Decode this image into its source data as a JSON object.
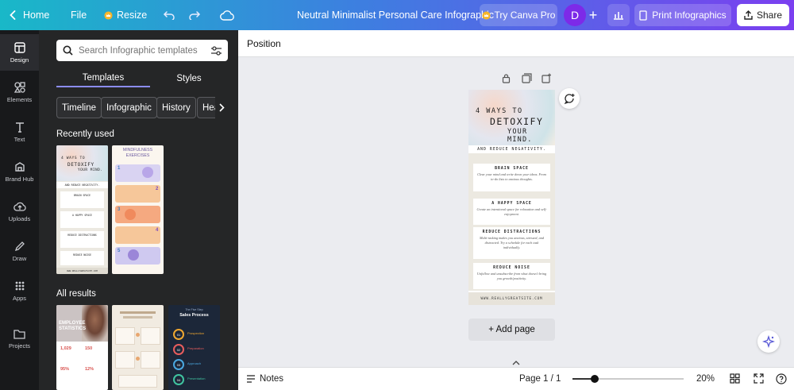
{
  "topbar": {
    "home_label": "Home",
    "file_label": "File",
    "resize_label": "Resize",
    "doc_title": "Neutral Minimalist Personal Care Infographic",
    "try_pro_label": "Try Canva Pro",
    "avatar_letter": "D",
    "print_label": "Print Infographics",
    "share_label": "Share"
  },
  "rail": {
    "items": [
      {
        "label": "Design",
        "icon": "design-icon"
      },
      {
        "label": "Elements",
        "icon": "elements-icon"
      },
      {
        "label": "Text",
        "icon": "text-icon"
      },
      {
        "label": "Brand Hub",
        "icon": "brand-hub-icon"
      },
      {
        "label": "Uploads",
        "icon": "uploads-icon"
      },
      {
        "label": "Draw",
        "icon": "draw-icon"
      },
      {
        "label": "Apps",
        "icon": "apps-icon"
      },
      {
        "label": "Projects",
        "icon": "projects-icon"
      }
    ]
  },
  "panel": {
    "search_placeholder": "Search Infographic templates",
    "tabs": [
      "Templates",
      "Styles"
    ],
    "chips": [
      "Timeline",
      "Infographic",
      "History",
      "Hea"
    ],
    "recently_used_title": "Recently used",
    "all_results_title": "All results",
    "thumb_detox": {
      "l1": "4 WAYS TO",
      "l2": "DETOXIFY",
      "l3": "YOUR MIND.",
      "l4": "AND REDUCE NEGATIVITY.",
      "sections": [
        "BRAIN SPACE",
        "A HAPPY SPACE",
        "REDUCE DISTRACTIONS",
        "REDUCE NOISE"
      ],
      "url": "WWW.REALLYGREATSITE.COM"
    },
    "thumb_mindful": {
      "title1": "MINDFULNESS",
      "title2": "EXERCISES",
      "nums": [
        "1",
        "2",
        "3",
        "4",
        "5"
      ]
    },
    "thumb_employee": {
      "title1": "EMPLOYEE",
      "title2": "STATISTICS",
      "n1": "1,029",
      "n2": "150",
      "p1": "95%",
      "p2": "12%"
    },
    "thumb_sales": {
      "title1": "The Five Step",
      "title2": "Sales Process",
      "steps": [
        "01",
        "02",
        "03",
        "04"
      ],
      "labels": [
        "Prospection",
        "Preparation",
        "Approach",
        "Presentation"
      ]
    }
  },
  "workarea": {
    "position_label": "Position",
    "add_page_label": "+ Add page",
    "notes_label": "Notes",
    "page_indicator": "Page 1 / 1",
    "zoom_label": "20%",
    "zoom_fraction": 0.2
  },
  "infographic": {
    "line1": "4 WAYS TO",
    "line2": "DETOXIFY",
    "line3": "YOUR MIND.",
    "subtitle": "AND REDUCE NEGATIVITY.",
    "cards": [
      {
        "title": "BRAIN SPACE",
        "text": "Clear your mind and write down your ideas. From to-do lists to anxious thoughts."
      },
      {
        "title": "A HAPPY SPACE",
        "text": "Create an intentional space for relaxation and self-enjoyment."
      },
      {
        "title": "REDUCE DISTRACTIONS",
        "text": "Multi-tasking makes you anxious, stressed, and distracted. Try a schedule for each task individually."
      },
      {
        "title": "REDUCE NOISE",
        "text": "Unfollow and unsubscribe from what doesn't bring you growth/positivity."
      }
    ],
    "footer": "WWW.REALLYGREATSITE.COM"
  }
}
